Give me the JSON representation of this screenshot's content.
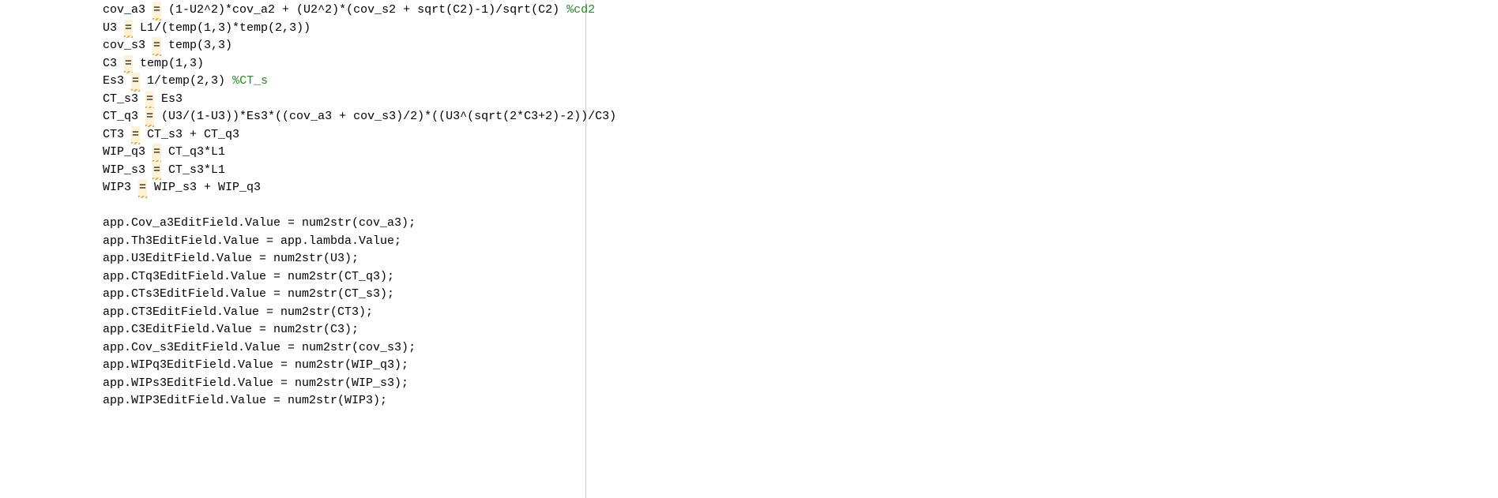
{
  "code": {
    "lines": [
      {
        "segments": [
          {
            "text": "cov_a3 ",
            "class": "tok-default"
          },
          {
            "text": "=",
            "class": "warn-highlight warn-under"
          },
          {
            "text": " (1-U2^2)*cov_a2 + (U2^2)*(cov_s2 + sqrt(C2)-1)/sqrt(C2) ",
            "class": "tok-default"
          },
          {
            "text": "%cd2",
            "class": "tok-comment"
          }
        ]
      },
      {
        "segments": [
          {
            "text": "U3 ",
            "class": "tok-default"
          },
          {
            "text": "=",
            "class": "warn-highlight warn-under"
          },
          {
            "text": " L1/(temp(1,3)*temp(2,3))",
            "class": "tok-default"
          }
        ]
      },
      {
        "segments": [
          {
            "text": "cov_s3 ",
            "class": "tok-default"
          },
          {
            "text": "=",
            "class": "warn-highlight warn-under"
          },
          {
            "text": " temp(3,3)",
            "class": "tok-default"
          }
        ]
      },
      {
        "segments": [
          {
            "text": "C3 ",
            "class": "tok-default"
          },
          {
            "text": "=",
            "class": "warn-highlight warn-under"
          },
          {
            "text": " temp(1,3)",
            "class": "tok-default"
          }
        ]
      },
      {
        "segments": [
          {
            "text": "Es3 ",
            "class": "tok-default"
          },
          {
            "text": "=",
            "class": "warn-highlight warn-under"
          },
          {
            "text": " 1/temp(2,3) ",
            "class": "tok-default"
          },
          {
            "text": "%CT_s",
            "class": "tok-comment"
          }
        ]
      },
      {
        "segments": [
          {
            "text": "CT_s3 ",
            "class": "tok-default"
          },
          {
            "text": "=",
            "class": "warn-highlight warn-under"
          },
          {
            "text": " Es3",
            "class": "tok-default"
          }
        ]
      },
      {
        "segments": [
          {
            "text": "CT_q3 ",
            "class": "tok-default"
          },
          {
            "text": "=",
            "class": "warn-highlight warn-under"
          },
          {
            "text": " (U3/(1-U3))*Es3*((cov_a3 + cov_s3)/2)*((U3^(sqrt(2*C3+2)-2))/C3)",
            "class": "tok-default"
          }
        ]
      },
      {
        "segments": [
          {
            "text": "CT3 ",
            "class": "tok-default"
          },
          {
            "text": "=",
            "class": "warn-highlight warn-under"
          },
          {
            "text": " CT_s3 + CT_q3",
            "class": "tok-default"
          }
        ]
      },
      {
        "segments": [
          {
            "text": "WIP_q3 ",
            "class": "tok-default"
          },
          {
            "text": "=",
            "class": "warn-highlight warn-under"
          },
          {
            "text": " CT_q3*L1",
            "class": "tok-default"
          }
        ]
      },
      {
        "segments": [
          {
            "text": "WIP_s3 ",
            "class": "tok-default"
          },
          {
            "text": "=",
            "class": "warn-highlight warn-under"
          },
          {
            "text": " CT_s3*L1",
            "class": "tok-default"
          }
        ]
      },
      {
        "segments": [
          {
            "text": "WIP3 ",
            "class": "tok-default"
          },
          {
            "text": "=",
            "class": "warn-highlight warn-under"
          },
          {
            "text": " WIP_s3 + WIP_q3",
            "class": "tok-default"
          }
        ]
      },
      {
        "segments": [
          {
            "text": "",
            "class": "tok-default"
          }
        ]
      },
      {
        "segments": [
          {
            "text": "app.Cov_a3EditField.Value = num2str(cov_a3);",
            "class": "tok-default"
          }
        ]
      },
      {
        "segments": [
          {
            "text": "app.Th3EditField.Value = app.lambda.Value;",
            "class": "tok-default"
          }
        ]
      },
      {
        "segments": [
          {
            "text": "app.U3EditField.Value = num2str(U3);",
            "class": "tok-default"
          }
        ]
      },
      {
        "segments": [
          {
            "text": "app.CTq3EditField.Value = num2str(CT_q3);",
            "class": "tok-default"
          }
        ]
      },
      {
        "segments": [
          {
            "text": "app.CTs3EditField.Value = num2str(CT_s3);",
            "class": "tok-default"
          }
        ]
      },
      {
        "segments": [
          {
            "text": "app.CT3EditField.Value = num2str(CT3);",
            "class": "tok-default"
          }
        ]
      },
      {
        "segments": [
          {
            "text": "app.C3EditField.Value = num2str(C3);",
            "class": "tok-default"
          }
        ]
      },
      {
        "segments": [
          {
            "text": "app.Cov_s3EditField.Value = num2str(cov_s3);",
            "class": "tok-default"
          }
        ]
      },
      {
        "segments": [
          {
            "text": "app.WIPq3EditField.Value = num2str(WIP_q3);",
            "class": "tok-default"
          }
        ]
      },
      {
        "segments": [
          {
            "text": "app.WIPs3EditField.Value = num2str(WIP_s3);",
            "class": "tok-default"
          }
        ]
      },
      {
        "segments": [
          {
            "text": "app.WIP3EditField.Value = num2str(WIP3);",
            "class": "tok-default"
          }
        ]
      }
    ]
  }
}
